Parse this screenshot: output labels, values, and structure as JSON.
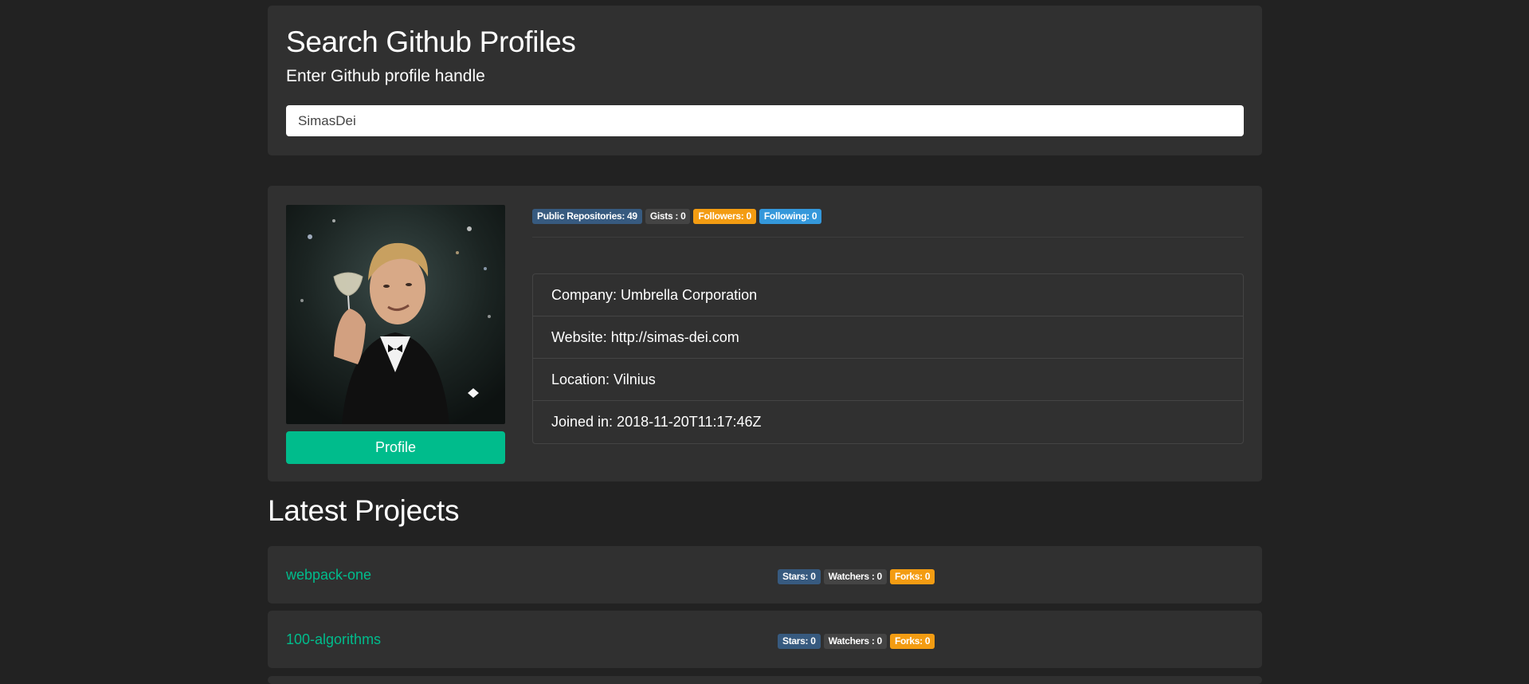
{
  "search": {
    "title": "Search Github Profiles",
    "subtitle": "Enter Github profile handle",
    "value": "SimasDei"
  },
  "profile": {
    "button_label": "Profile",
    "badges": {
      "repos": "Public Repositories: 49",
      "gists": "Gists : 0",
      "followers": "Followers: 0",
      "following": "Following: 0"
    },
    "info": {
      "company": "Company: Umbrella Corporation",
      "website": "Website: http://simas-dei.com",
      "location": "Location: Vilnius",
      "joined": "Joined in: 2018-11-20T11:17:46Z"
    }
  },
  "projects": {
    "title": "Latest Projects",
    "items": [
      {
        "name": "webpack-one",
        "stars": "Stars: 0",
        "watchers": "Watchers : 0",
        "forks": "Forks: 0"
      },
      {
        "name": "100-algorithms",
        "stars": "Stars: 0",
        "watchers": "Watchers : 0",
        "forks": "Forks: 0"
      }
    ]
  },
  "colors": {
    "background": "#222222",
    "card": "#303030",
    "accent": "#00bc8c",
    "badge_primary": "#375a7f",
    "badge_secondary": "#444444",
    "badge_warning": "#f39c12",
    "badge_info": "#3498db"
  }
}
